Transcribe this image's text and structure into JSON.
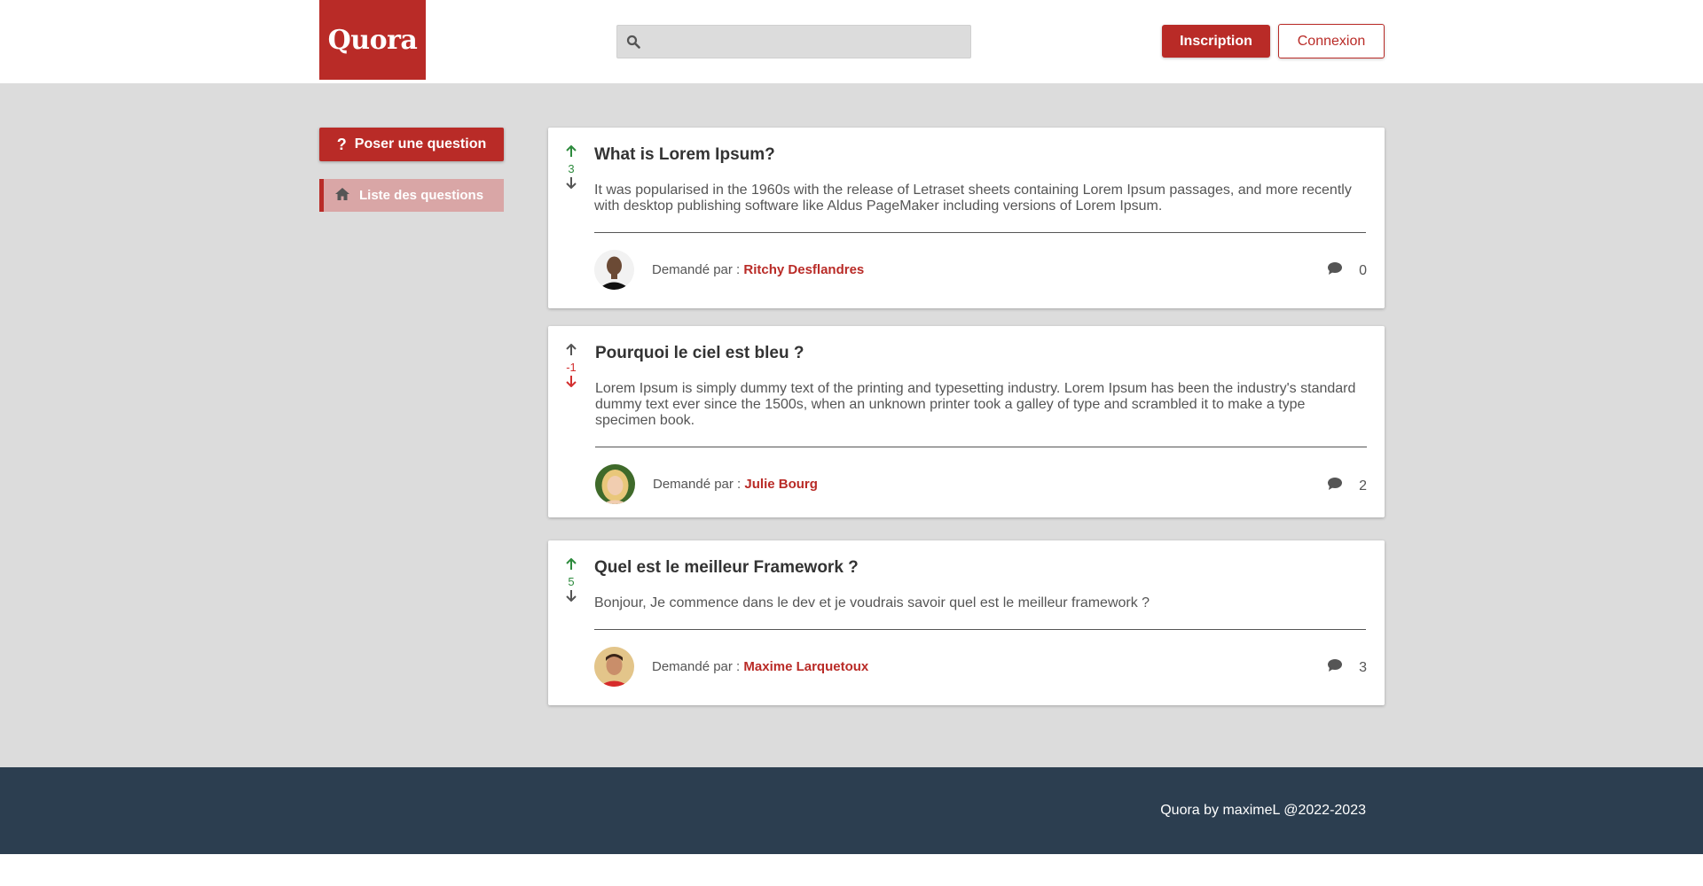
{
  "header": {
    "logo": "Quora",
    "search_placeholder": "",
    "signup_label": "Inscription",
    "login_label": "Connexion"
  },
  "sidebar": {
    "ask_icon": "?",
    "ask_label": "Poser une question",
    "nav_label": "Liste des questions"
  },
  "questions": [
    {
      "title": "What is Lorem Ipsum?",
      "body": "It was popularised in the 1960s with the release of Letraset sheets containing Lorem Ipsum passages, and more recently with desktop publishing software like Aldus PageMaker including versions of Lorem Ipsum.",
      "votes": "3",
      "asked_label": "Demandé par : ",
      "author": "Ritchy Desflandres",
      "comments": "0"
    },
    {
      "title": "Pourquoi le ciel est bleu ?",
      "body": "Lorem Ipsum is simply dummy text of the printing and typesetting industry. Lorem Ipsum has been the industry's standard dummy text ever since the 1500s, when an unknown printer took a galley of type and scrambled it to make a type specimen book.",
      "votes": "-1",
      "asked_label": "Demandé par : ",
      "author": "Julie Bourg",
      "comments": "2"
    },
    {
      "title": "Quel est le meilleur Framework ?",
      "body": "Bonjour, Je commence dans le dev et je voudrais savoir quel est le meilleur framework ?",
      "votes": "5",
      "asked_label": "Demandé par : ",
      "author": "Maxime Larquetoux",
      "comments": "3"
    }
  ],
  "footer": {
    "text": "Quora by maximeL @2022-2023"
  },
  "colors": {
    "brand": "#b92b27",
    "upvote": "#2e8b3e",
    "downvote": "#d32f2f",
    "footer_bg": "#2c3e50"
  },
  "icons": {
    "search": "search-icon",
    "home": "home-icon",
    "up": "arrow-up-icon",
    "down": "arrow-down-icon",
    "comment": "comment-icon"
  }
}
